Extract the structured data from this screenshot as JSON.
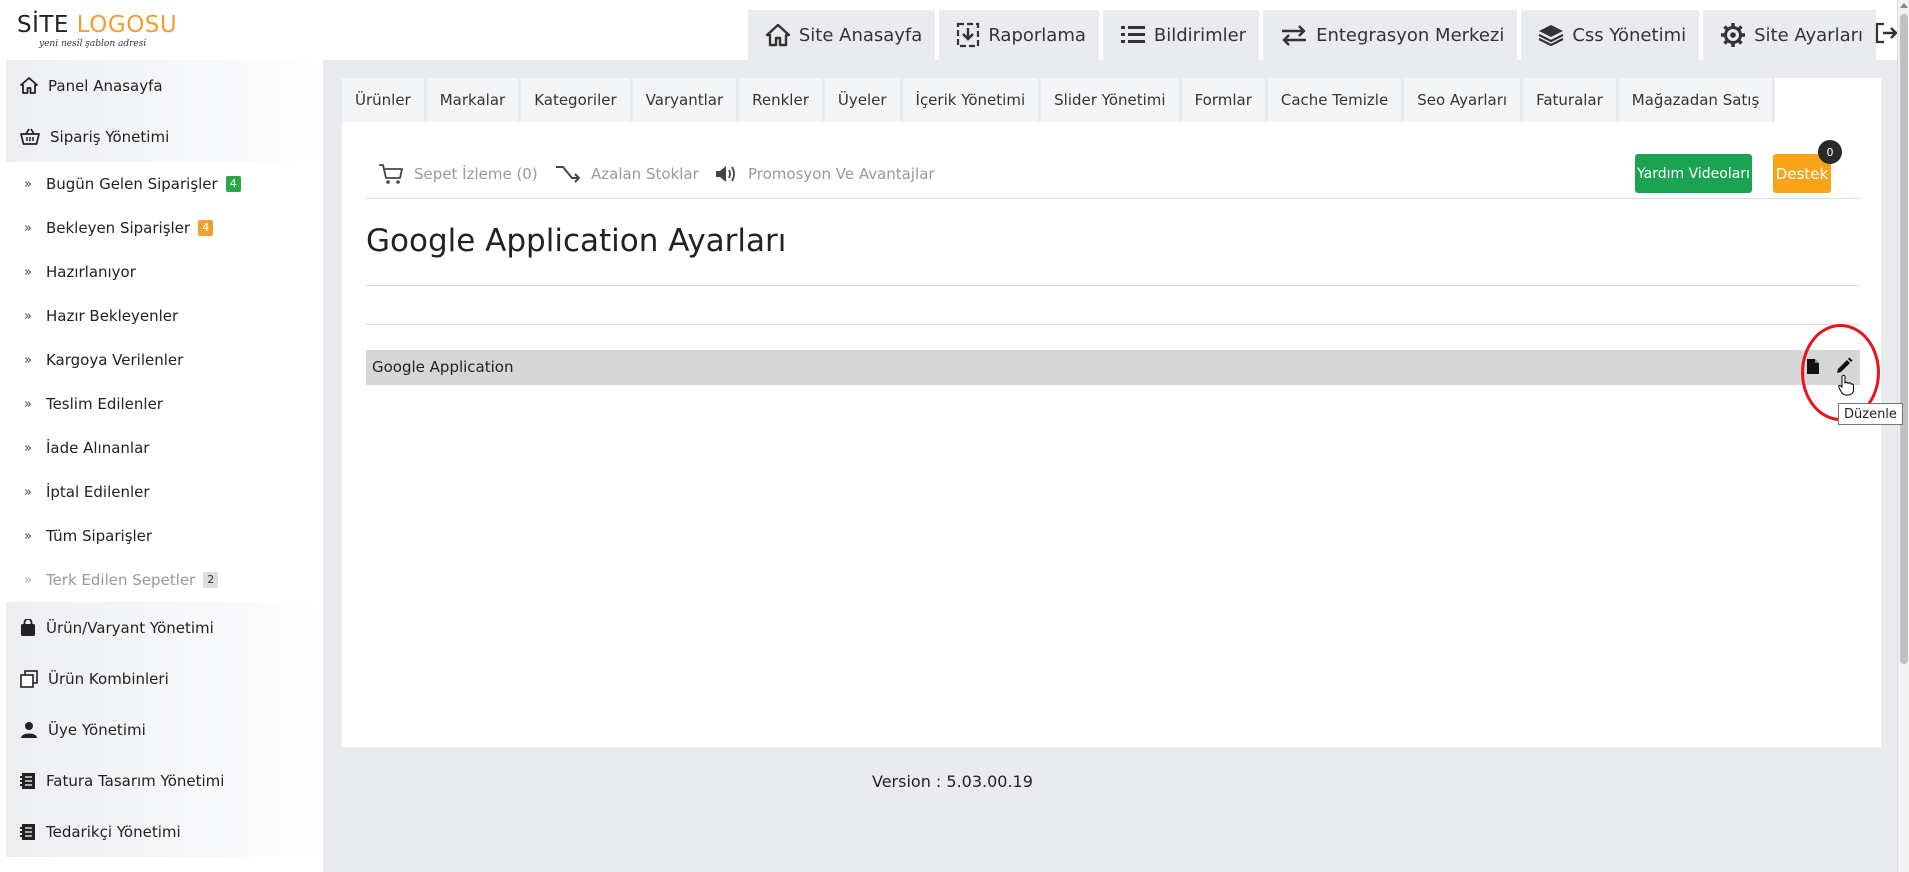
{
  "logo": {
    "word1": "SİTE",
    "word2": "LOGOSU",
    "tagline": "yeni nesil şablon adresi"
  },
  "topnav": [
    {
      "label": "Site Anasayfa",
      "icon": "home-icon"
    },
    {
      "label": "Raporlama",
      "icon": "download-icon"
    },
    {
      "label": "Bildirimler",
      "icon": "list-icon"
    },
    {
      "label": "Entegrasyon Merkezi",
      "icon": "exchange-icon"
    },
    {
      "label": "Css Yönetimi",
      "icon": "layers-icon"
    },
    {
      "label": "Site Ayarları",
      "icon": "gear-icon"
    }
  ],
  "sidebar": {
    "panel": "Panel Anasayfa",
    "orders": "Sipariş Yönetimi",
    "order_items": [
      {
        "label": "Bugün Gelen Siparişler",
        "badge": "4"
      },
      {
        "label": "Bekleyen Siparişler",
        "badge": "4"
      },
      {
        "label": "Hazırlanıyor"
      },
      {
        "label": "Hazır Bekleyenler"
      },
      {
        "label": "Kargoya Verilenler"
      },
      {
        "label": "Teslim Edilenler"
      },
      {
        "label": "İade Alınanlar"
      },
      {
        "label": "İptal Edilenler"
      },
      {
        "label": "Tüm Siparişler"
      },
      {
        "label": "Terk Edilen Sepetler",
        "badge": "2"
      }
    ],
    "products": "Ürün/Varyant Yönetimi",
    "combos": "Ürün Kombinleri",
    "members": "Üye Yönetimi",
    "invoice": "Fatura Tasarım Yönetimi",
    "suppliers": "Tedarikçi Yönetimi"
  },
  "tabs": [
    "Ürünler",
    "Markalar",
    "Kategoriler",
    "Varyantlar",
    "Renkler",
    "Üyeler",
    "İçerik Yönetimi",
    "Slider Yönetimi",
    "Formlar",
    "Cache Temizle",
    "Seo Ayarları",
    "Faturalar",
    "Mağazadan Satış"
  ],
  "toolbar": {
    "cart": "Sepet İzleme (0)",
    "stock": "Azalan Stoklar",
    "promo": "Promosyon Ve Avantajlar",
    "help": "Yardım Videoları",
    "support": "Destek",
    "support_count": "0"
  },
  "page": {
    "title": "Google Application Ayarları",
    "row_name": "Google Application",
    "tooltip": "Düzenle"
  },
  "version": "Version : 5.03.00.19",
  "colors": {
    "accent_orange": "#f0a030",
    "green": "#1aa350",
    "support": "#f9a31a",
    "annotation": "#e8141b"
  }
}
